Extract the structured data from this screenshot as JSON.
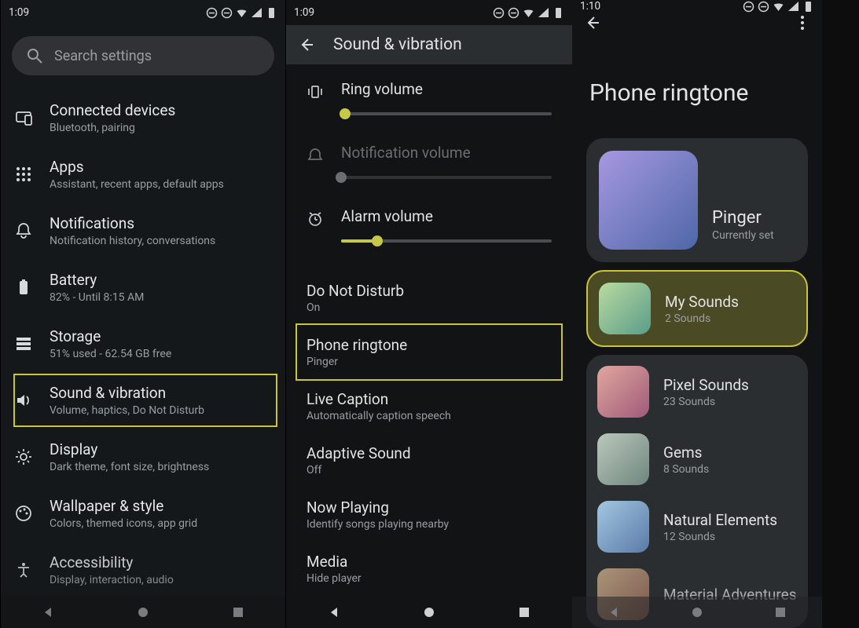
{
  "screen1": {
    "time": "1:09",
    "search_placeholder": "Search settings",
    "items": [
      {
        "title": "Connected devices",
        "sub": "Bluetooth, pairing"
      },
      {
        "title": "Apps",
        "sub": "Assistant, recent apps, default apps"
      },
      {
        "title": "Notifications",
        "sub": "Notification history, conversations"
      },
      {
        "title": "Battery",
        "sub": "82% - Until 8:15 AM"
      },
      {
        "title": "Storage",
        "sub": "51% used - 62.54 GB free"
      },
      {
        "title": "Sound & vibration",
        "sub": "Volume, haptics, Do Not Disturb"
      },
      {
        "title": "Display",
        "sub": "Dark theme, font size, brightness"
      },
      {
        "title": "Wallpaper & style",
        "sub": "Colors, themed icons, app grid"
      },
      {
        "title": "Accessibility",
        "sub": "Display, interaction, audio"
      }
    ]
  },
  "screen2": {
    "time": "1:09",
    "header": "Sound & vibration",
    "ring_label": "Ring volume",
    "notif_label": "Notification volume",
    "alarm_label": "Alarm volume",
    "rows": [
      {
        "title": "Do Not Disturb",
        "sub": "On"
      },
      {
        "title": "Phone ringtone",
        "sub": "Pinger"
      },
      {
        "title": "Live Caption",
        "sub": "Automatically caption speech"
      },
      {
        "title": "Adaptive Sound",
        "sub": "Off"
      },
      {
        "title": "Now Playing",
        "sub": "Identify songs playing nearby"
      },
      {
        "title": "Media",
        "sub": "Hide player"
      }
    ]
  },
  "screen3": {
    "time": "1:10",
    "title": "Phone ringtone",
    "current": {
      "title": "Pinger",
      "sub": "Currently set"
    },
    "cats": [
      {
        "title": "My Sounds",
        "sub": "2 Sounds"
      },
      {
        "title": "Pixel Sounds",
        "sub": "23 Sounds"
      },
      {
        "title": "Gems",
        "sub": "8 Sounds"
      },
      {
        "title": "Natural Elements",
        "sub": "12 Sounds"
      },
      {
        "title": "Material Adventures",
        "sub": ""
      }
    ]
  }
}
